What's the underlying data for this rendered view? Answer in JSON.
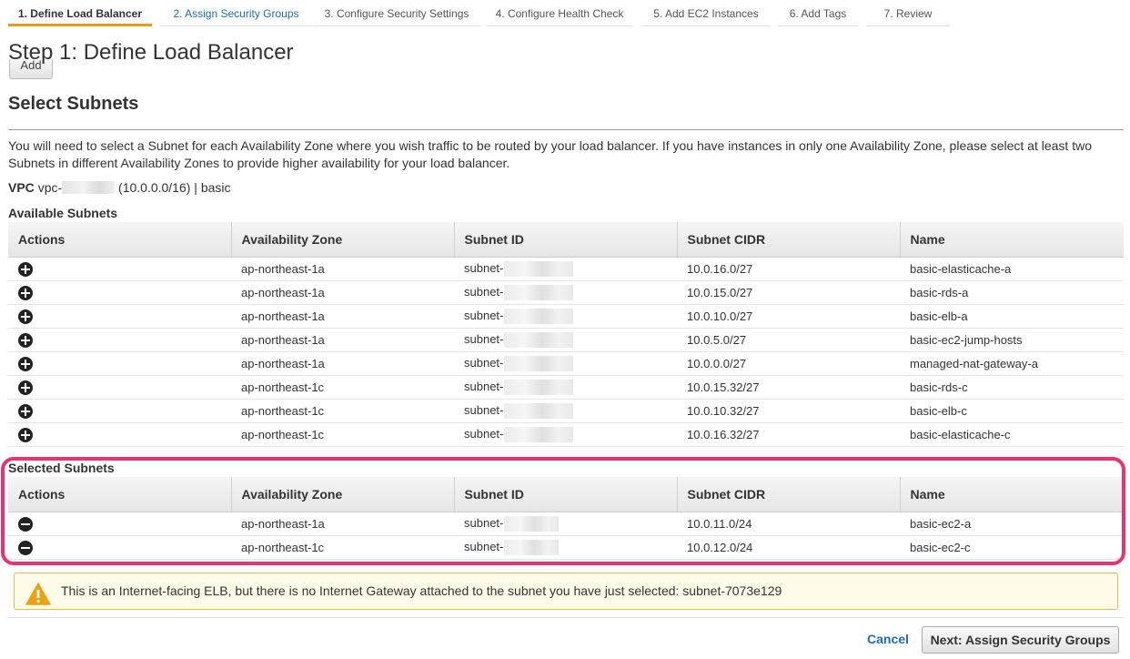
{
  "wizard": {
    "tabs": [
      {
        "label": "1. Define Load Balancer",
        "state": "active"
      },
      {
        "label": "2. Assign Security Groups",
        "state": "link"
      },
      {
        "label": "3. Configure Security Settings",
        "state": "disabled"
      },
      {
        "label": "4. Configure Health Check",
        "state": "disabled"
      },
      {
        "label": "5. Add EC2 Instances",
        "state": "disabled"
      },
      {
        "label": "6. Add Tags",
        "state": "disabled"
      },
      {
        "label": "7. Review",
        "state": "disabled"
      }
    ],
    "accent_color": "#e39a24",
    "link_color": "#1f6cb3"
  },
  "page": {
    "title": "Step 1: Define Load Balancer",
    "add_button_label": "Add",
    "section_title": "Select Subnets",
    "description": "You will need to select a Subnet for each Availability Zone where you wish traffic to be routed by your load balancer. If you have instances in only one Availability Zone, please select at least two Subnets in different Availability Zones to provide higher availability for your load balancer.",
    "vpc_label": "VPC",
    "vpc_prefix": "vpc-",
    "vpc_suffix": "(10.0.0.0/16) | basic"
  },
  "available_subnets": {
    "title": "Available Subnets",
    "columns": [
      "Actions",
      "Availability Zone",
      "Subnet ID",
      "Subnet CIDR",
      "Name"
    ],
    "action_icon": "plus-circle-icon",
    "rows": [
      {
        "az": "ap-northeast-1a",
        "subnet_prefix": "subnet-",
        "cidr": "10.0.16.0/27",
        "name": "basic-elasticache-a"
      },
      {
        "az": "ap-northeast-1a",
        "subnet_prefix": "subnet-",
        "cidr": "10.0.15.0/27",
        "name": "basic-rds-a"
      },
      {
        "az": "ap-northeast-1a",
        "subnet_prefix": "subnet-",
        "cidr": "10.0.10.0/27",
        "name": "basic-elb-a"
      },
      {
        "az": "ap-northeast-1a",
        "subnet_prefix": "subnet-",
        "cidr": "10.0.5.0/27",
        "name": "basic-ec2-jump-hosts"
      },
      {
        "az": "ap-northeast-1a",
        "subnet_prefix": "subnet-",
        "cidr": "10.0.0.0/27",
        "name": "managed-nat-gateway-a"
      },
      {
        "az": "ap-northeast-1c",
        "subnet_prefix": "subnet-",
        "cidr": "10.0.15.32/27",
        "name": "basic-rds-c"
      },
      {
        "az": "ap-northeast-1c",
        "subnet_prefix": "subnet-",
        "cidr": "10.0.10.32/27",
        "name": "basic-elb-c"
      },
      {
        "az": "ap-northeast-1c",
        "subnet_prefix": "subnet-",
        "cidr": "10.0.16.32/27",
        "name": "basic-elasticache-c"
      }
    ]
  },
  "selected_subnets": {
    "title": "Selected Subnets",
    "columns": [
      "Actions",
      "Availability Zone",
      "Subnet ID",
      "Subnet CIDR",
      "Name"
    ],
    "action_icon": "minus-circle-icon",
    "highlight_color": "#e8336f",
    "rows": [
      {
        "az": "ap-northeast-1a",
        "subnet_prefix": "subnet-",
        "cidr": "10.0.11.0/24",
        "name": "basic-ec2-a"
      },
      {
        "az": "ap-northeast-1c",
        "subnet_prefix": "subnet-",
        "cidr": "10.0.12.0/24",
        "name": "basic-ec2-c"
      }
    ]
  },
  "warning": {
    "icon": "warning-triangle-icon",
    "text": "This is an Internet-facing ELB, but there is no Internet Gateway attached to the subnet you have just selected: subnet-7073e129",
    "color": "#e8a317"
  },
  "footer": {
    "cancel_label": "Cancel",
    "next_label": "Next: Assign Security Groups"
  }
}
